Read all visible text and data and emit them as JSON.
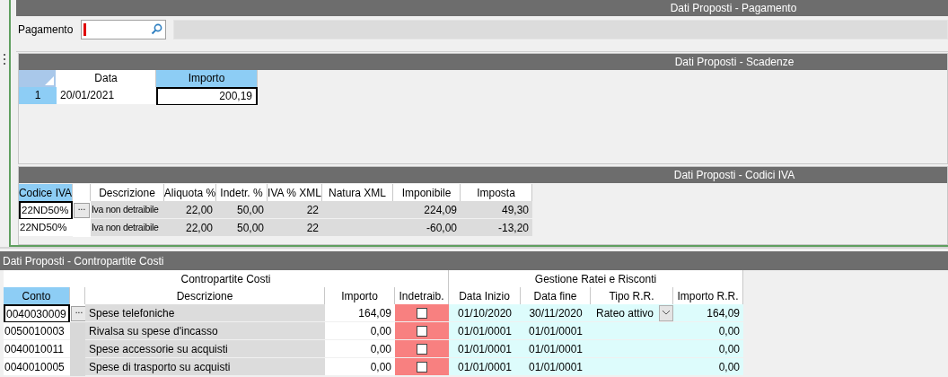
{
  "pagamento": {
    "title": "Dati Proposti - Pagamento",
    "label": "Pagamento"
  },
  "scadenze": {
    "title": "Dati Proposti - Scadenze",
    "columns": [
      {
        "label": "Data",
        "selected": false
      },
      {
        "label": "Importo",
        "selected": true
      }
    ],
    "rows": [
      {
        "number": "1",
        "selected": true,
        "data": "20/01/2021",
        "importo": "200,19"
      }
    ]
  },
  "codici_iva": {
    "title": "Dati Proposti - Codici IVA",
    "columns": [
      {
        "label": "Codice IVA",
        "selected": true
      },
      {
        "label": "Descrizione",
        "selected": false
      },
      {
        "label": "Aliquota %",
        "selected": false
      },
      {
        "label": "Indetr. %",
        "selected": false
      },
      {
        "label": "IVA % XML",
        "selected": false
      },
      {
        "label": "Natura XML",
        "selected": false
      },
      {
        "label": "Imponibile",
        "selected": false
      },
      {
        "label": "Imposta",
        "selected": false
      }
    ],
    "rows": [
      {
        "selected": true,
        "codice": "22ND50%",
        "button": "...",
        "descrizione": "Iva non detraibile",
        "aliquota": "22,00",
        "indetr": "50,00",
        "iva_xml": "22",
        "imponibile": "224,09",
        "imposta": "49,30"
      },
      {
        "selected": false,
        "codice": "22ND50%",
        "descrizione": "Iva non detraibile",
        "aliquota": "22,00",
        "indetr": "50,00",
        "iva_xml": "22",
        "imponibile": "-60,00",
        "imposta": "-13,20"
      }
    ]
  },
  "contropartite": {
    "title": "Dati Proposti - Contropartite Costi",
    "groups": [
      "Contropartite Costi",
      "Gestione Ratei e Risconti"
    ],
    "columns": [
      {
        "label": "Conto",
        "selected": true
      },
      {
        "label": "Descrizione",
        "selected": false
      },
      {
        "label": "Importo",
        "selected": false
      },
      {
        "label": "Indetraib.",
        "selected": false
      },
      {
        "label": "Data Inizio",
        "selected": false
      },
      {
        "label": "Data fine",
        "selected": false
      },
      {
        "label": "Tipo R.R.",
        "selected": false
      },
      {
        "label": "Importo R.R.",
        "selected": false
      }
    ],
    "rows": [
      {
        "selected": true,
        "conto": "0040030009",
        "button": "...",
        "descrizione": "Spese telefoniche",
        "importo": "164,09",
        "indetraibile": false,
        "data_inizio": "01/10/2020",
        "data_fine": "30/11/2020",
        "tipo": "Rateo attivo",
        "importo_rr": "164,09"
      },
      {
        "selected": false,
        "conto": "0050010003",
        "descrizione": "Rivalsa su spese d'incasso",
        "importo": "0,00",
        "indetraibile": false,
        "data_inizio": "01/01/0001",
        "data_fine": "01/01/0001",
        "importo_rr": "0,00"
      },
      {
        "selected": false,
        "conto": "0040010011",
        "descrizione": "Spese accessorie su acquisti",
        "importo": "0,00",
        "indetraibile": false,
        "data_inizio": "01/01/0001",
        "data_fine": "01/01/0001",
        "importo_rr": "0,00"
      },
      {
        "selected": false,
        "conto": "0040010005",
        "descrizione": "Spese di trasporto su acquisti",
        "importo": "0,00",
        "indetraibile": false,
        "data_inizio": "01/01/0001",
        "data_fine": "01/01/0001",
        "importo_rr": "0,00"
      }
    ]
  }
}
